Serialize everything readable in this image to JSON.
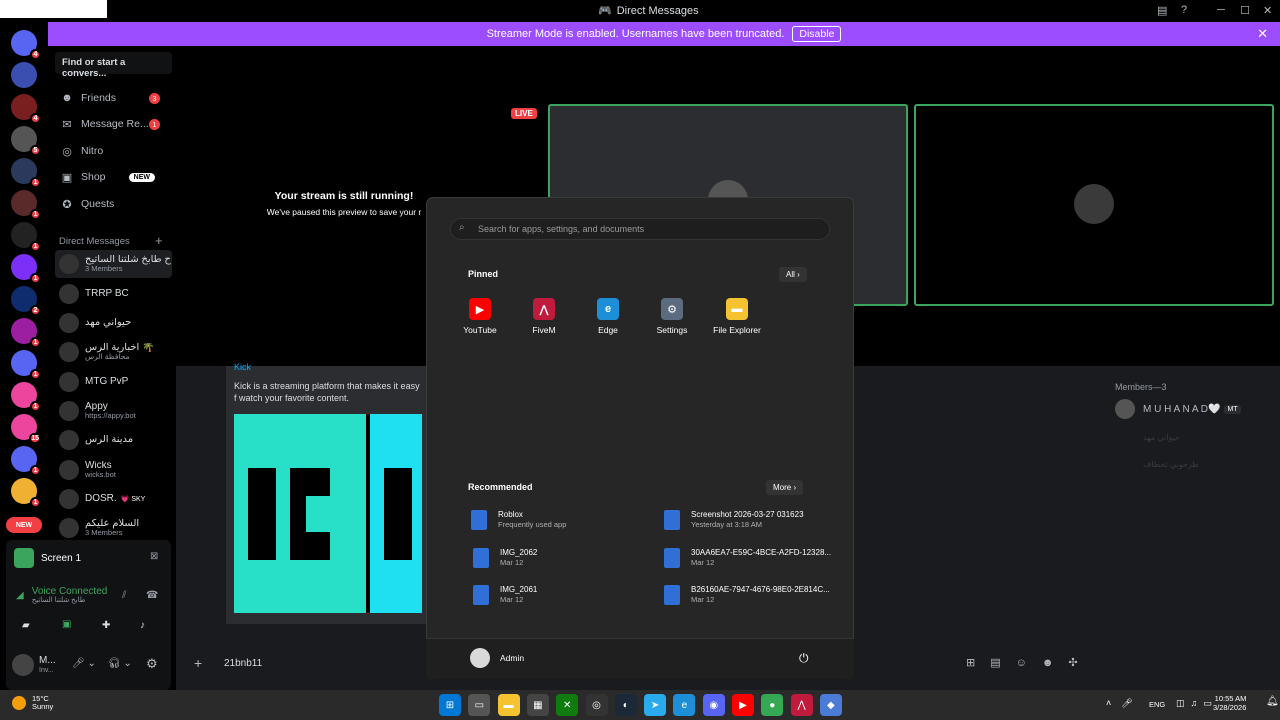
{
  "window": {
    "title": "Direct Messages",
    "controls": [
      "─",
      "☐",
      "✕"
    ]
  },
  "banner": {
    "text": "Streamer Mode is enabled. Usernames have been truncated.",
    "button": "Disable"
  },
  "servers": [
    {
      "badge": "4",
      "color": "#5865f2"
    },
    {
      "badge": "",
      "color": "#3b4fb0"
    },
    {
      "badge": "4",
      "color": "#7a1f1f"
    },
    {
      "badge": "5",
      "color": "#555"
    },
    {
      "badge": "1",
      "color": "#2b3a5c"
    },
    {
      "badge": "1",
      "color": "#5a2a2a"
    },
    {
      "badge": "1",
      "color": "#222"
    },
    {
      "badge": "1",
      "color": "#7b2ff7"
    },
    {
      "badge": "2",
      "color": "#0f2c6e"
    },
    {
      "badge": "1",
      "color": "#9b1fa0"
    },
    {
      "badge": "1",
      "color": "#5865f2"
    },
    {
      "badge": "1",
      "color": "#eb459e"
    },
    {
      "badge": "15",
      "color": "#eb459e"
    },
    {
      "badge": "1",
      "color": "#5865f2"
    },
    {
      "badge": "1",
      "color": "#f0b132"
    }
  ],
  "new_pill": "NEW",
  "sidebar": {
    "find": "Find or start a convers...",
    "nav": [
      {
        "label": "Friends",
        "icon": "☻",
        "count": "3"
      },
      {
        "label": "Message Re...",
        "icon": "✉",
        "count": "1"
      },
      {
        "label": "Nitro",
        "icon": "◎",
        "count": ""
      },
      {
        "label": "Shop",
        "icon": "▣",
        "count": "",
        "new": "NEW"
      },
      {
        "label": "Quests",
        "icon": "✪",
        "count": ""
      }
    ],
    "dm_header": "Direct Messages",
    "dms": [
      {
        "name": "ح طابخ شلتنا الساتيح",
        "sub": "3 Members"
      },
      {
        "name": "TRRP BC",
        "sub": ""
      },
      {
        "name": "حيواني مهد",
        "sub": ""
      },
      {
        "name": "أخبارية الرس 🌴",
        "sub": "محافظة الرس"
      },
      {
        "name": "MTG PvP",
        "sub": ""
      },
      {
        "name": "Appy",
        "sub": "https://appy.bot"
      },
      {
        "name": "مدينة الرس",
        "sub": ""
      },
      {
        "name": "Wicks",
        "sub": "wicks.bot"
      },
      {
        "name": "DOSR.",
        "sub": "",
        "tag": "💗 SKY"
      },
      {
        "name": "السلام عليكم",
        "sub": "3 Members"
      }
    ]
  },
  "screen_panel": {
    "title": "Screen 1",
    "voice": "Voice Connected",
    "channel": "طابخ شلتنا الساتيح"
  },
  "user": {
    "name": "M...",
    "status": "Inv..."
  },
  "stream": {
    "live": "LIVE",
    "still_running": "Your stream is still running!",
    "paused": "We've paused this preview to save your r"
  },
  "kick": {
    "title": "Kick",
    "desc": "Kick is a streaming platform that makes it easy f watch your favorite content."
  },
  "chat": {
    "input": "21bnb11"
  },
  "members": {
    "header": "Members—3",
    "first": "M U H A N A D🤍",
    "tag": "MT",
    "second": "حيواني مهد",
    "third": "طرحوني تحطاف"
  },
  "start_menu": {
    "search": "Search for apps, settings, and documents",
    "pinned_label": "Pinned",
    "all_button": "All",
    "pinned": [
      {
        "label": "YouTube",
        "icon": "▶",
        "color": "#ff0000"
      },
      {
        "label": "FiveM",
        "icon": "⋀",
        "color": "#c01a3c"
      },
      {
        "label": "Edge",
        "icon": "e",
        "color": "#1d8ed8"
      },
      {
        "label": "Settings",
        "icon": "⚙",
        "color": "#5c6b80"
      },
      {
        "label": "File Explorer",
        "icon": "▬",
        "color": "#f4c32f"
      }
    ],
    "recommended_label": "Recommended",
    "more_button": "More",
    "recommended": [
      {
        "title": "Roblox",
        "sub": "Frequently used app"
      },
      {
        "title": "Screenshot 2026-03-27 031623",
        "sub": "Yesterday at 3:18 AM"
      },
      {
        "title": "IMG_2062",
        "sub": "Mar 12"
      },
      {
        "title": "30AA6EA7-E59C-4BCE-A2FD-12328...",
        "sub": "Mar 12"
      },
      {
        "title": "IMG_2061",
        "sub": "Mar 12"
      },
      {
        "title": "B26160AE-7947-4676-98E0-2E814C...",
        "sub": "Mar 12"
      }
    ],
    "user": "Admin"
  },
  "taskbar": {
    "weather_temp": "15°C",
    "weather_desc": "Sunny",
    "lang": "ENG",
    "time": "10:55 AM",
    "date": "3/28/2026"
  }
}
